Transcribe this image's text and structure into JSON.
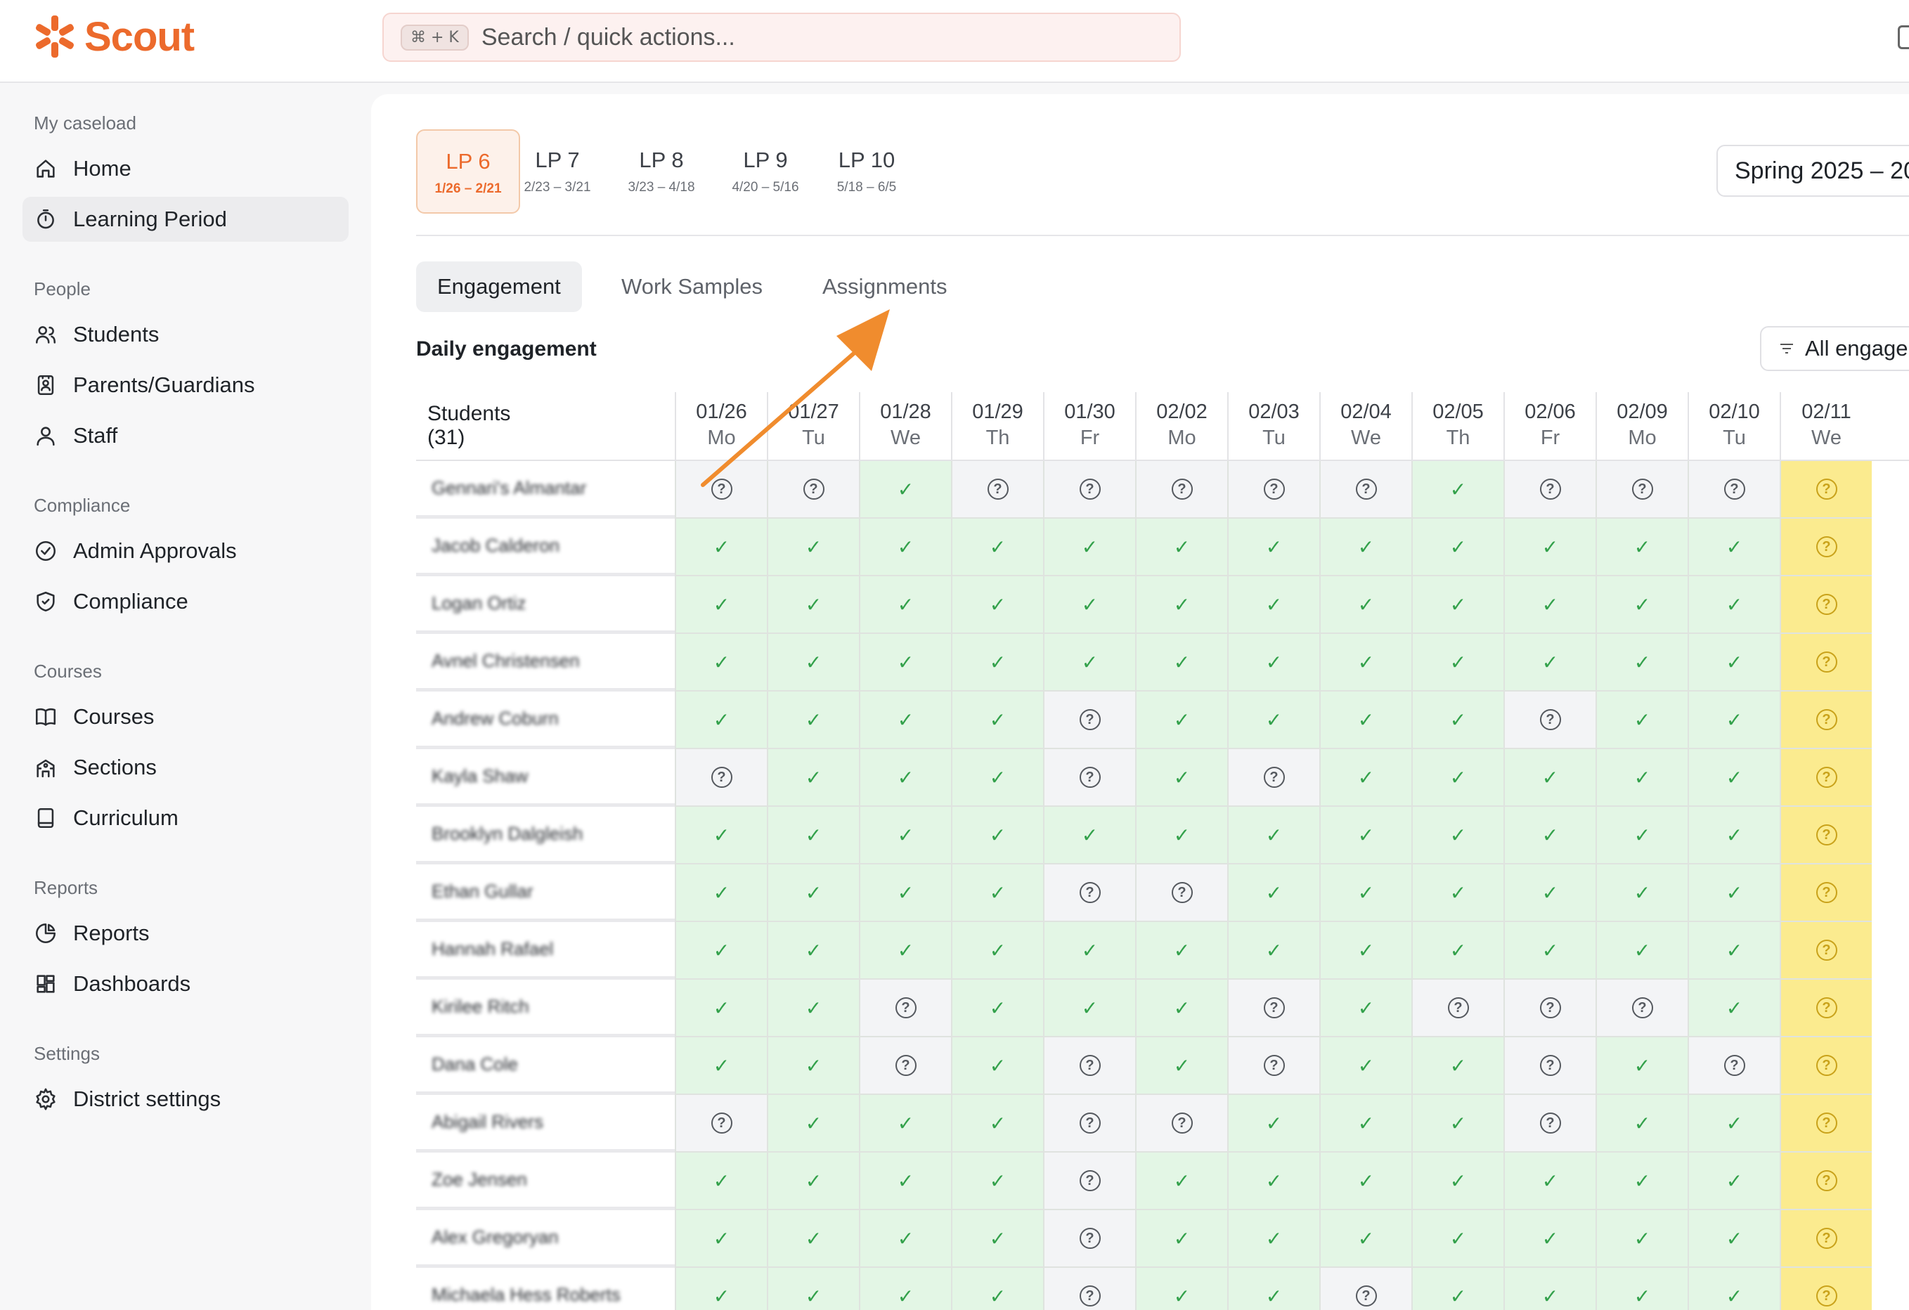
{
  "app": {
    "name": "Scout",
    "brand_color": "#ec6a2c"
  },
  "search": {
    "shortcut": "⌘ + K",
    "placeholder": "Search / quick actions..."
  },
  "sidebar": {
    "sections": [
      {
        "label": "My caseload",
        "items": [
          {
            "label": "Home",
            "icon": "home-icon"
          },
          {
            "label": "Learning Period",
            "icon": "timer-icon",
            "active": true
          }
        ]
      },
      {
        "label": "People",
        "items": [
          {
            "label": "Students",
            "icon": "users-icon"
          },
          {
            "label": "Parents/Guardians",
            "icon": "contact-card-icon"
          },
          {
            "label": "Staff",
            "icon": "user-icon"
          }
        ]
      },
      {
        "label": "Compliance",
        "items": [
          {
            "label": "Admin Approvals",
            "icon": "check-circle-icon"
          },
          {
            "label": "Compliance",
            "icon": "shield-check-icon"
          }
        ]
      },
      {
        "label": "Courses",
        "items": [
          {
            "label": "Courses",
            "icon": "open-book-icon"
          },
          {
            "label": "Sections",
            "icon": "school-icon"
          },
          {
            "label": "Curriculum",
            "icon": "notebook-icon"
          }
        ]
      },
      {
        "label": "Reports",
        "items": [
          {
            "label": "Reports",
            "icon": "pie-chart-icon"
          },
          {
            "label": "Dashboards",
            "icon": "dashboard-icon"
          }
        ]
      },
      {
        "label": "Settings",
        "items": [
          {
            "label": "District settings",
            "icon": "gear-icon"
          }
        ]
      }
    ]
  },
  "learning_periods": [
    {
      "label": "LP 6",
      "dates": "1/26 – 2/21",
      "active": true
    },
    {
      "label": "LP 7",
      "dates": "2/23 – 3/21"
    },
    {
      "label": "LP 8",
      "dates": "3/23 – 4/18"
    },
    {
      "label": "LP 9",
      "dates": "4/20 – 5/16"
    },
    {
      "label": "LP 10",
      "dates": "5/18 – 6/5"
    }
  ],
  "term_selector": "Spring 2025 – 20",
  "tabs": [
    {
      "label": "Engagement",
      "active": true
    },
    {
      "label": "Work Samples"
    },
    {
      "label": "Assignments"
    }
  ],
  "section_title": "Daily engagement",
  "filter_label": "All engager",
  "grid": {
    "students_header": "Students (31)",
    "dates": [
      {
        "date": "01/26",
        "day": "Mo"
      },
      {
        "date": "01/27",
        "day": "Tu"
      },
      {
        "date": "01/28",
        "day": "We"
      },
      {
        "date": "01/29",
        "day": "Th"
      },
      {
        "date": "01/30",
        "day": "Fr"
      },
      {
        "date": "02/02",
        "day": "Mo"
      },
      {
        "date": "02/03",
        "day": "Tu"
      },
      {
        "date": "02/04",
        "day": "We"
      },
      {
        "date": "02/05",
        "day": "Th"
      },
      {
        "date": "02/06",
        "day": "Fr"
      },
      {
        "date": "02/09",
        "day": "Mo"
      },
      {
        "date": "02/10",
        "day": "Tu"
      },
      {
        "date": "02/11",
        "day": "We"
      }
    ],
    "today_index": 12,
    "rows": [
      {
        "name": "Gennari's Almantar",
        "status": "??v?????v????"
      },
      {
        "name": "Jacob Calderon",
        "status": "vvvvvvvvvvvv?"
      },
      {
        "name": "Logan Ortiz",
        "status": "vvvvvvvvvvvv?"
      },
      {
        "name": "Avnel Christensen",
        "status": "vvvvvvvvvvvv?"
      },
      {
        "name": "Andrew Coburn",
        "status": "vvvv?vvvv?vv?"
      },
      {
        "name": "Kayla Shaw",
        "status": "?vvv?v?vvvvv?"
      },
      {
        "name": "Brooklyn Dalgleish",
        "status": "vvvvvvvvvvvv?"
      },
      {
        "name": "Ethan Gullar",
        "status": "vvvv??vvvvvv?"
      },
      {
        "name": "Hannah Rafael",
        "status": "vvvvvvvvvvvv?"
      },
      {
        "name": "Kirilee Ritch",
        "status": "vv?vvv?v???v?"
      },
      {
        "name": "Dana Cole",
        "status": "vv?v?v?vv?v??"
      },
      {
        "name": "Abigail Rivers",
        "status": "?vvv??vvv?vv?"
      },
      {
        "name": "Zoe Jensen",
        "status": "vvvv?vvvvvvv?"
      },
      {
        "name": "Alex Gregoryan",
        "status": "vvvv?vvvvvvv?"
      },
      {
        "name": "Michaela Hess Roberts",
        "status": "vvvv?vv?vvvv?"
      }
    ]
  },
  "colors": {
    "engaged": "#e3f6e5",
    "unknown": "#f3f4f6",
    "today": "#fbeb8f",
    "annotation_arrow": "#f08c2e"
  }
}
